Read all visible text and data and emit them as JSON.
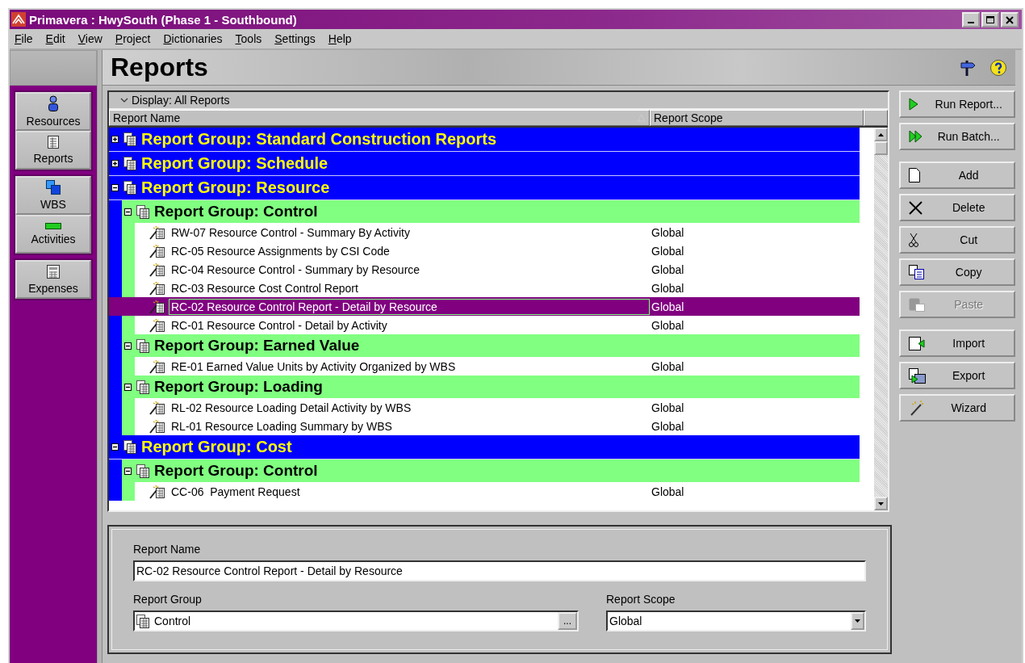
{
  "window": {
    "title": "Primavera : HwySouth (Phase 1 - Southbound)"
  },
  "menu": [
    {
      "label": "File"
    },
    {
      "label": "Edit"
    },
    {
      "label": "View"
    },
    {
      "label": "Project"
    },
    {
      "label": "Dictionaries"
    },
    {
      "label": "Tools"
    },
    {
      "label": "Settings"
    },
    {
      "label": "Help"
    }
  ],
  "sidebar": {
    "groups": [
      {
        "items": [
          {
            "label": "Resources",
            "kind": "resources",
            "selected": false
          },
          {
            "label": "Reports",
            "kind": "reports",
            "selected": false
          }
        ]
      },
      {
        "items": [
          {
            "label": "WBS",
            "kind": "wbs",
            "selected": false
          },
          {
            "label": "Activities",
            "kind": "activities",
            "selected": false
          }
        ]
      },
      {
        "items": [
          {
            "label": "Expenses",
            "kind": "expenses",
            "selected": false
          }
        ]
      }
    ]
  },
  "page_title": "Reports",
  "display_filter": "Display: All Reports",
  "columns": [
    "Report Name",
    "Report Scope"
  ],
  "report_groups": [
    {
      "label": "Report Group: Standard Construction Reports",
      "expanded": false
    },
    {
      "label": "Report Group: Schedule",
      "expanded": false
    },
    {
      "label": "Report Group: Resource",
      "expanded": true,
      "children": [
        {
          "label": "Report Group: Control",
          "expanded": true,
          "children": [
            {
              "name": "RW-07 Resource Control - Summary By Activity",
              "scope": "Global",
              "selected": false
            },
            {
              "name": "RC-05 Resource Assignments by CSI Code",
              "scope": "Global",
              "selected": false
            },
            {
              "name": "RC-04 Resource Control - Summary by Resource",
              "scope": "Global",
              "selected": false
            },
            {
              "name": "RC-03 Resource Cost Control Report",
              "scope": "Global",
              "selected": false
            },
            {
              "name": "RC-02 Resource Control Report - Detail by Resource",
              "scope": "Global",
              "selected": true
            },
            {
              "name": "RC-01 Resource Control - Detail by Activity",
              "scope": "Global",
              "selected": false
            }
          ]
        },
        {
          "label": "Report Group: Earned Value",
          "expanded": true,
          "children": [
            {
              "name": "RE-01 Earned Value Units by Activity Organized by WBS",
              "scope": "Global",
              "selected": false
            }
          ]
        },
        {
          "label": "Report Group: Loading",
          "expanded": true,
          "children": [
            {
              "name": "RL-02 Resource Loading Detail Activity by WBS",
              "scope": "Global",
              "selected": false
            },
            {
              "name": "RL-01 Resource Loading Summary by WBS",
              "scope": "Global",
              "selected": false
            }
          ]
        }
      ]
    },
    {
      "label": "Report Group: Cost",
      "expanded": true,
      "children": [
        {
          "label": "Report Group: Control",
          "expanded": true,
          "children": [
            {
              "name": "CC-06  Payment Request",
              "scope": "Global",
              "selected": false
            }
          ]
        }
      ]
    }
  ],
  "actions": [
    {
      "buttons": [
        {
          "label": "Run Report...",
          "kind": "run",
          "disabled": false
        },
        {
          "label": "Run Batch...",
          "kind": "batch",
          "disabled": false
        }
      ]
    },
    {
      "buttons": [
        {
          "label": "Add",
          "kind": "add",
          "disabled": false
        },
        {
          "label": "Delete",
          "kind": "delete",
          "disabled": false
        },
        {
          "label": "Cut",
          "kind": "cut",
          "disabled": false
        },
        {
          "label": "Copy",
          "kind": "copy",
          "disabled": false
        },
        {
          "label": "Paste",
          "kind": "paste",
          "disabled": true
        }
      ]
    },
    {
      "buttons": [
        {
          "label": "Import",
          "kind": "import",
          "disabled": false
        },
        {
          "label": "Export",
          "kind": "export",
          "disabled": false
        },
        {
          "label": "Wizard",
          "kind": "wizard",
          "disabled": false
        }
      ]
    }
  ],
  "details": {
    "report_name": {
      "label": "Report Name",
      "value": "RC-02 Resource Control Report - Detail by Resource"
    },
    "report_group": {
      "label": "Report Group",
      "value": "Control",
      "browse": "..."
    },
    "report_scope": {
      "label": "Report Scope",
      "value": "Global"
    }
  }
}
